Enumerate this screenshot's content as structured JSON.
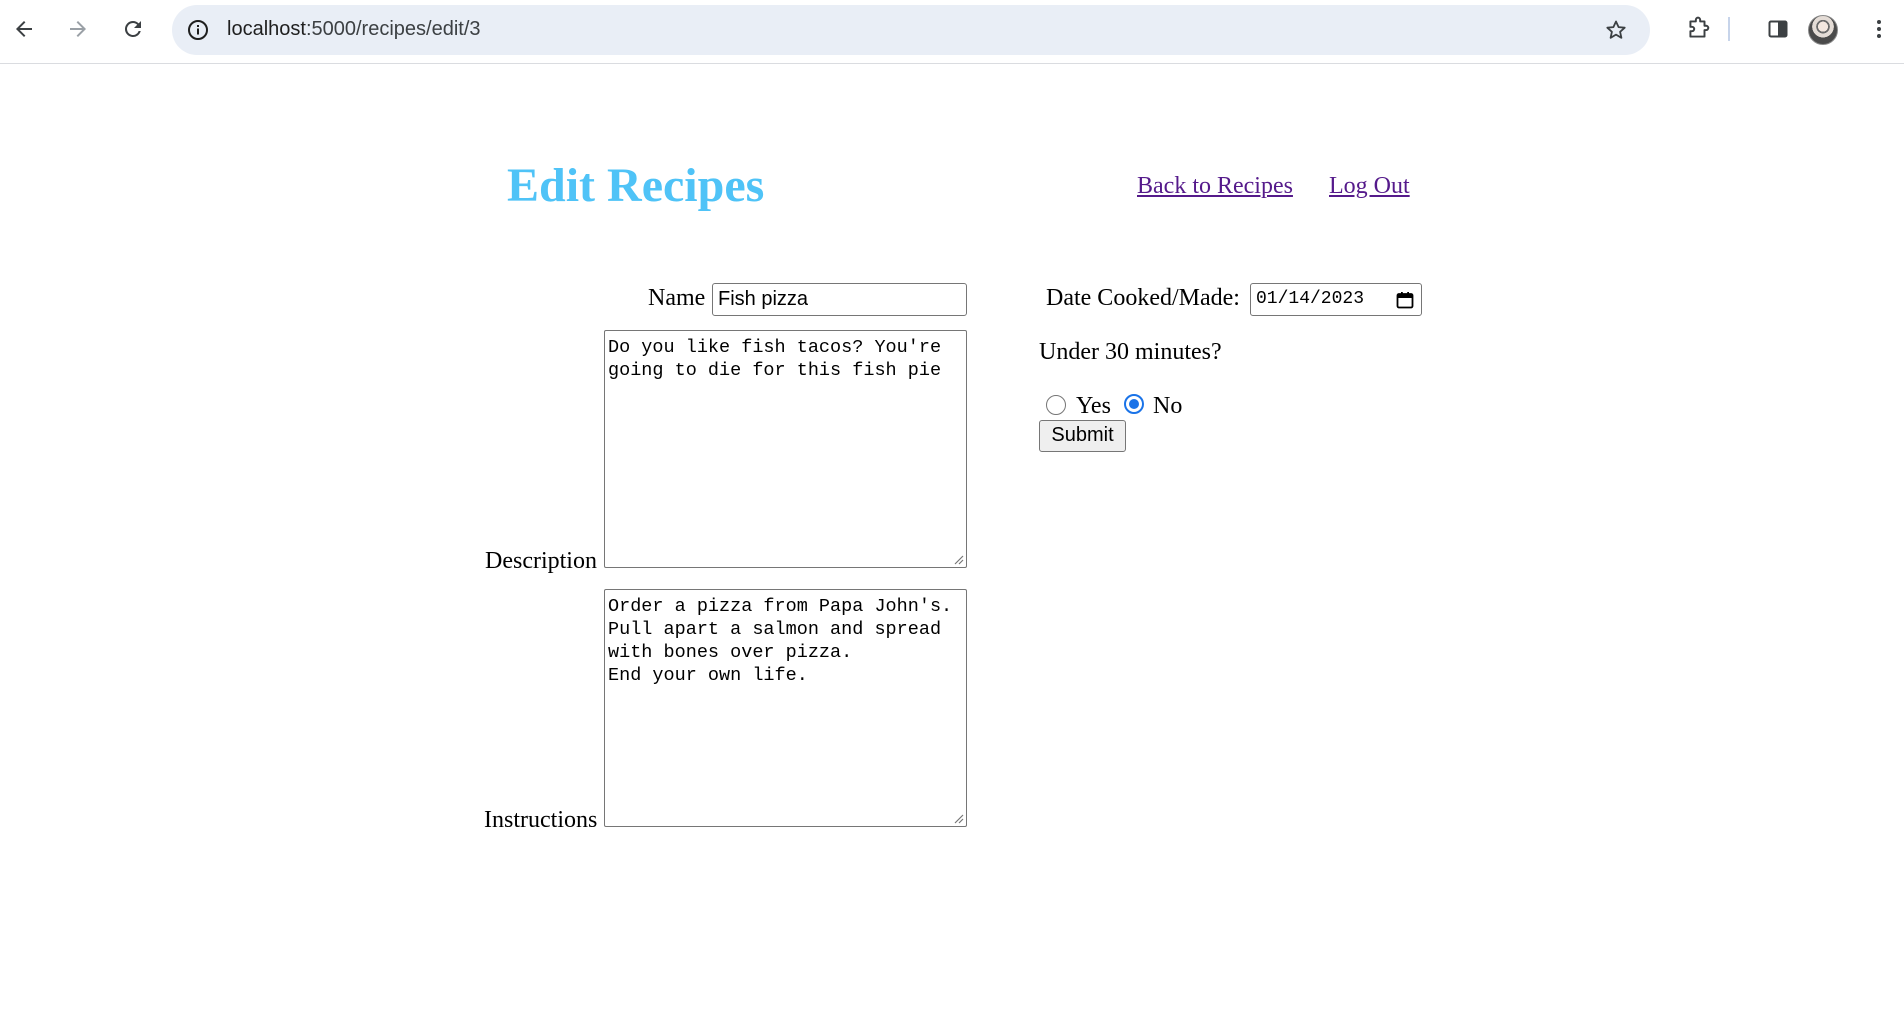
{
  "browser": {
    "url_host": "localhost",
    "url_path": ":5000/recipes/edit/3"
  },
  "header": {
    "title": "Edit Recipes",
    "title_color": "#4fc3f7",
    "links": [
      {
        "label": "Back to Recipes"
      },
      {
        "label": "Log Out"
      }
    ],
    "link_color": "#551a8b"
  },
  "form": {
    "name_label": "Name",
    "name_value": "Fish pizza",
    "description_label": "Description",
    "description_lines": [
      "Do you like fish tacos? You're",
      "going to die for this fish pie"
    ],
    "instructions_label": "Instructions",
    "instructions_lines": [
      "Order a pizza from Papa John's.",
      "Pull apart a salmon and spread",
      "with bones over pizza.",
      "End your own life."
    ],
    "date_label": "Date Cooked/Made:",
    "date_value": "01/14/2023",
    "under30_label": "Under 30 minutes?",
    "radio_yes_label": "Yes",
    "radio_no_label": "No",
    "selected": "No",
    "submit_label": "Submit",
    "accent_color": "#1a73e8"
  }
}
